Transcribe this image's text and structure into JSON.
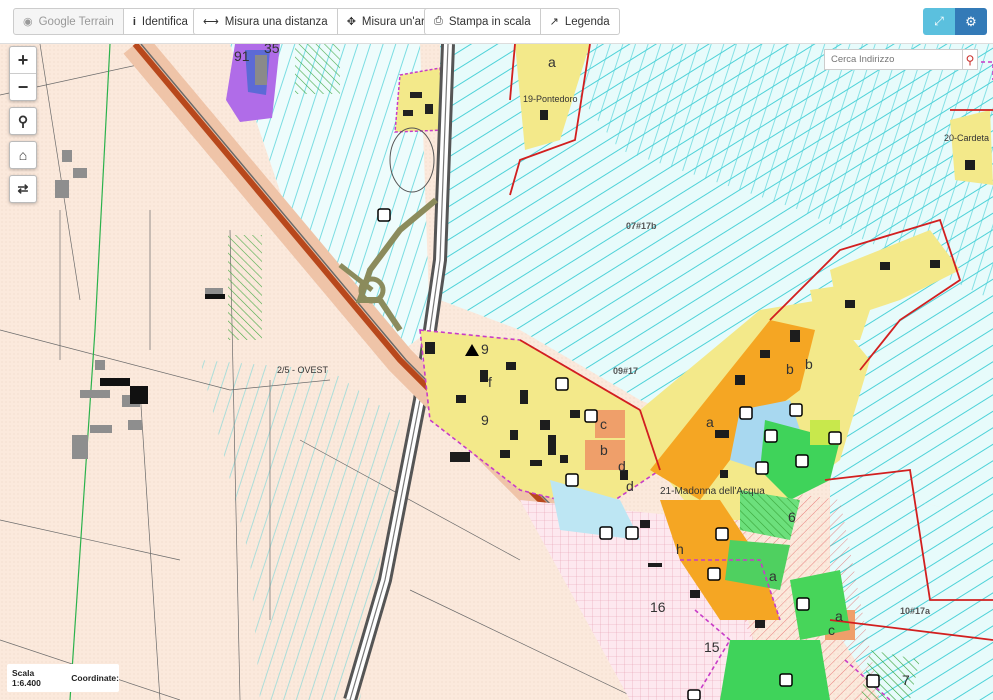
{
  "toolbar": {
    "google_terrain": "Google Terrain",
    "identifica": "Identifica",
    "misura_distanza": "Misura una distanza",
    "misura_area": "Misura un'area",
    "stampa": "Stampa in scala",
    "legenda": "Legenda"
  },
  "search": {
    "placeholder": "Cerca Indirizzo"
  },
  "status": {
    "scale_label": "Scala 1:6.400",
    "coord_label": "Coordinate:"
  },
  "map_labels": {
    "pontedoro": "19-Pontedoro",
    "cardeta": "20-Cardeta",
    "zone_07": "07#17b",
    "zone_09": "09#17",
    "zone_10": "10#17a",
    "ovest": "2/5 - OVEST",
    "madonna": "21-Madonna dell'Acqua",
    "n16": "16",
    "n9a": "9",
    "n9b": "9",
    "n6": "6",
    "n7": "7",
    "n15": "15",
    "n35": "35",
    "n91": "91",
    "a1": "a",
    "a2": "a",
    "a3": "a",
    "a4": "a",
    "b1": "b",
    "b2": "b",
    "b3": "b",
    "c1": "c",
    "c2": "c",
    "d1": "d",
    "d2": "d",
    "f1": "f",
    "h1": "h"
  },
  "colors": {
    "agri_bg": "#fbe9dc",
    "cyan_lines": "#4dd2d8",
    "yellow_zone": "#f3e98a",
    "orange_zone": "#f5a623",
    "green_zone": "#3fd35a",
    "boundary_red": "#d21f1f",
    "boundary_magenta": "#c83cc8",
    "rail_gray": "#555555",
    "road_red": "#b8481c"
  }
}
